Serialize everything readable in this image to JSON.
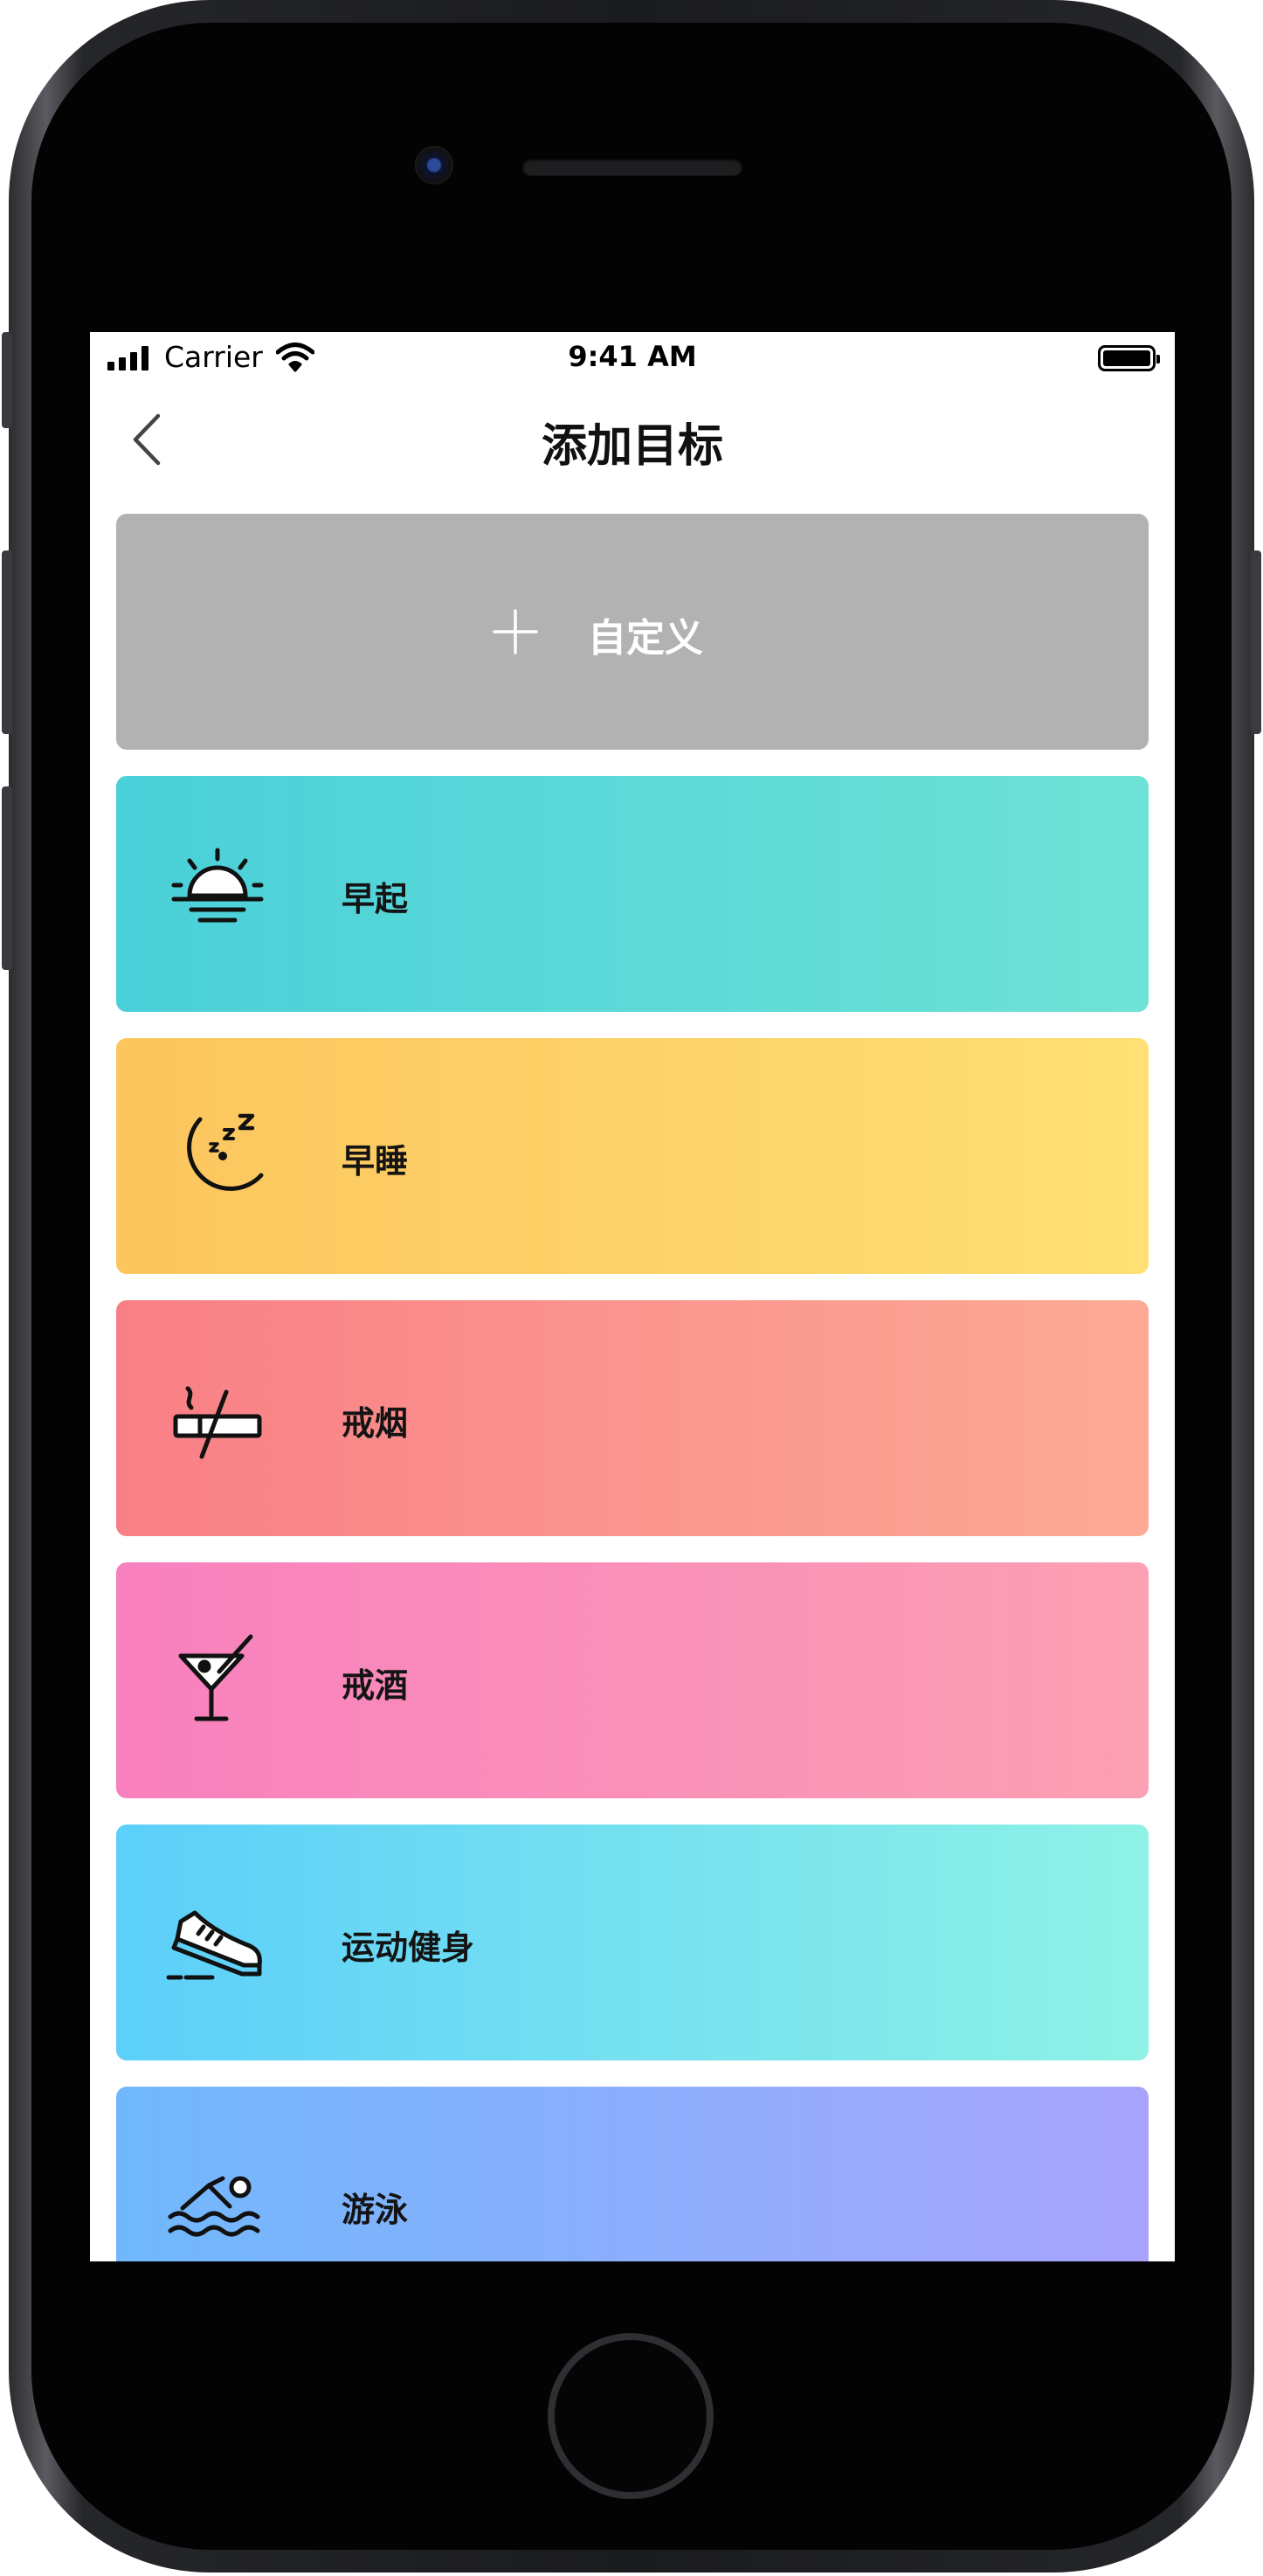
{
  "status_bar": {
    "carrier": "Carrier",
    "time": "9:41 AM"
  },
  "nav": {
    "title": "添加目标",
    "back_icon": "chevron-left-icon"
  },
  "custom": {
    "label": "自定义",
    "icon": "plus-icon",
    "color": "#b2b2b2"
  },
  "goals": [
    {
      "label": "早起",
      "icon": "sunrise-icon",
      "colors": [
        "#4ad0d9",
        "#6ee2d6"
      ]
    },
    {
      "label": "早睡",
      "icon": "moon-sleep-icon",
      "colors": [
        "#fcc55d",
        "#fee074"
      ]
    },
    {
      "label": "戒烟",
      "icon": "no-smoking-icon",
      "colors": [
        "#f97f86",
        "#fcaa95"
      ]
    },
    {
      "label": "戒酒",
      "icon": "cocktail-icon",
      "colors": [
        "#f880be",
        "#fca0b3"
      ]
    },
    {
      "label": "运动健身",
      "icon": "sneaker-icon",
      "colors": [
        "#5ccffa",
        "#8ef2e6"
      ]
    },
    {
      "label": "游泳",
      "icon": "swimmer-icon",
      "colors": [
        "#70b8fc",
        "#a8a4fc"
      ]
    }
  ]
}
